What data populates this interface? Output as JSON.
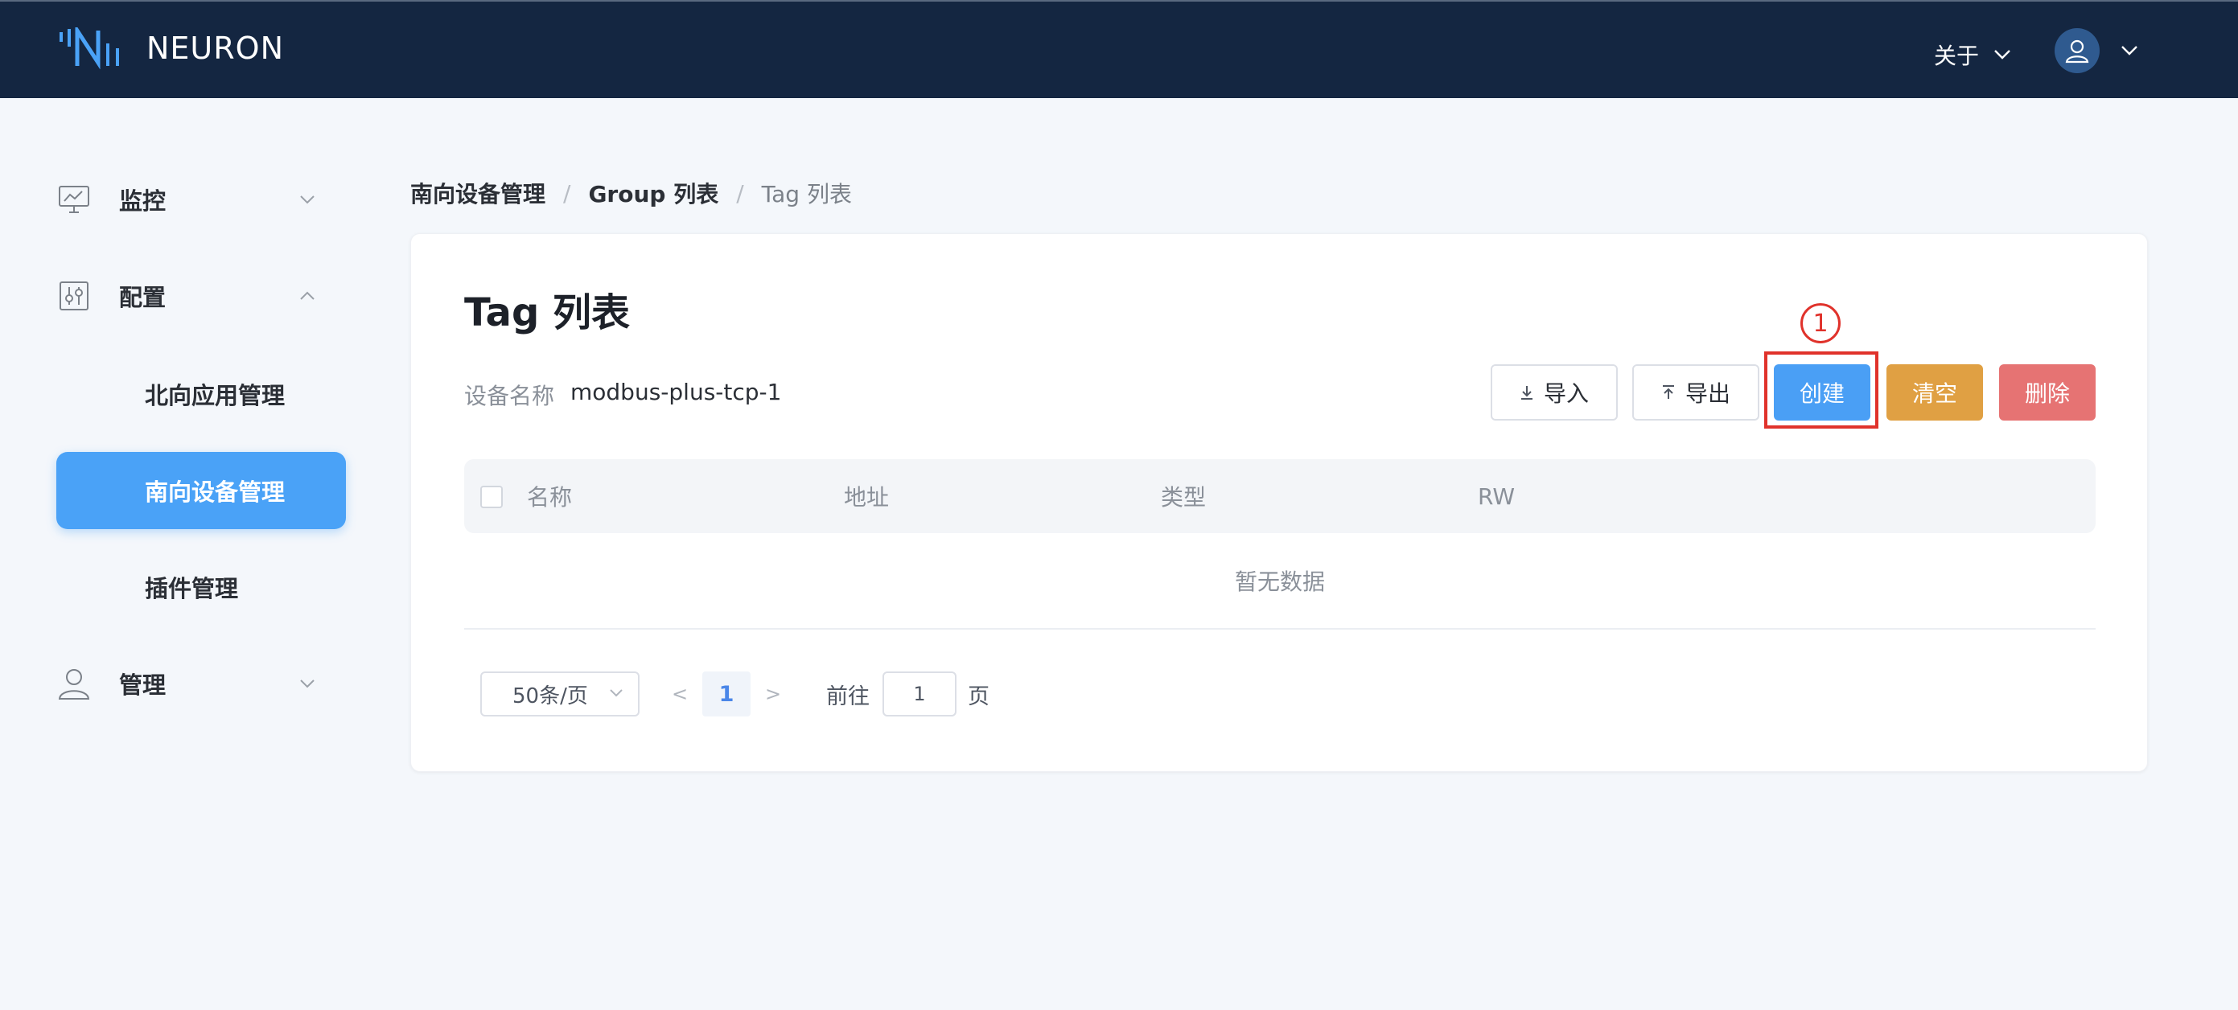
{
  "header": {
    "brand": "NEURON",
    "about_label": "关于"
  },
  "sidebar": {
    "groups": [
      {
        "label": "监控",
        "icon": "monitor-chart-icon",
        "expanded": false
      },
      {
        "label": "配置",
        "icon": "config-sliders-icon",
        "expanded": true
      },
      {
        "label": "管理",
        "icon": "user-icon",
        "expanded": false
      }
    ],
    "config_items": [
      {
        "label": "北向应用管理",
        "active": false
      },
      {
        "label": "南向设备管理",
        "active": true
      },
      {
        "label": "插件管理",
        "active": false
      }
    ]
  },
  "breadcrumb": [
    "南向设备管理",
    "Group 列表",
    "Tag 列表"
  ],
  "page": {
    "title": "Tag 列表",
    "device_label": "设备名称",
    "device_name": "modbus-plus-tcp-1"
  },
  "toolbar": {
    "import_label": "导入",
    "export_label": "导出",
    "create_label": "创建",
    "clear_label": "清空",
    "delete_label": "删除",
    "step_marker": "1"
  },
  "table": {
    "columns": [
      "名称",
      "地址",
      "类型",
      "RW"
    ],
    "rows": [],
    "empty_text": "暂无数据"
  },
  "pagination": {
    "page_size": "50条/页",
    "current_page": "1",
    "prev": "<",
    "next": ">",
    "goto_label": "前往",
    "goto_value": "1",
    "goto_suffix": "页"
  },
  "colors": {
    "header_bg": "#142641",
    "primary": "#4a9ff5",
    "warning": "#e0a043",
    "danger": "#e67373",
    "annotation": "#e0322b"
  }
}
